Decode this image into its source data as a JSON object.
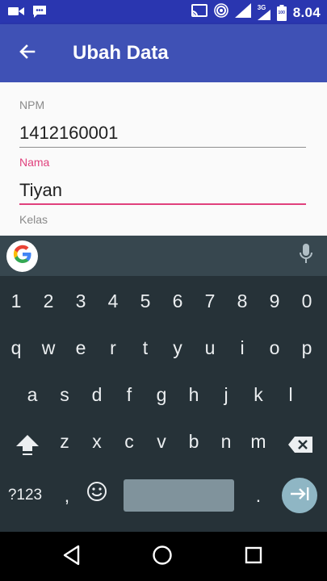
{
  "status_bar": {
    "time": "8.04",
    "network_badge": "3G",
    "battery_level": "100",
    "icons": [
      "video-camera-icon",
      "chat-icon",
      "cast-icon",
      "hotspot-icon",
      "signal-icon",
      "battery-icon"
    ]
  },
  "app_bar": {
    "title": "Ubah Data",
    "back_icon": "arrow-left-icon"
  },
  "form": {
    "fields": [
      {
        "label": "NPM",
        "value": "1412160001",
        "focused": false
      },
      {
        "label": "Nama",
        "value": "Tiyan",
        "focused": true
      },
      {
        "label": "Kelas",
        "value": "",
        "focused": false
      }
    ]
  },
  "keyboard": {
    "rows": [
      [
        "1",
        "2",
        "3",
        "4",
        "5",
        "6",
        "7",
        "8",
        "9",
        "0"
      ],
      [
        "q",
        "w",
        "e",
        "r",
        "t",
        "y",
        "u",
        "i",
        "o",
        "p"
      ],
      [
        "a",
        "s",
        "d",
        "f",
        "g",
        "h",
        "j",
        "k",
        "l"
      ],
      [
        "z",
        "x",
        "c",
        "v",
        "b",
        "n",
        "m"
      ]
    ],
    "symbols_label": "?123",
    "comma_label": ",",
    "period_label": ".",
    "icons": [
      "google-icon",
      "microphone-icon",
      "shift-icon",
      "backspace-icon",
      "emoji-icon",
      "enter-icon"
    ]
  },
  "colors": {
    "status_bar": "#2a36b0",
    "app_bar": "#3f51b5",
    "accent": "#e0407c",
    "keyboard_bg": "#263238",
    "keyboard_top": "#37474f"
  },
  "nav_bar": {
    "icons": [
      "back-triangle-icon",
      "home-circle-icon",
      "recents-square-icon"
    ]
  }
}
